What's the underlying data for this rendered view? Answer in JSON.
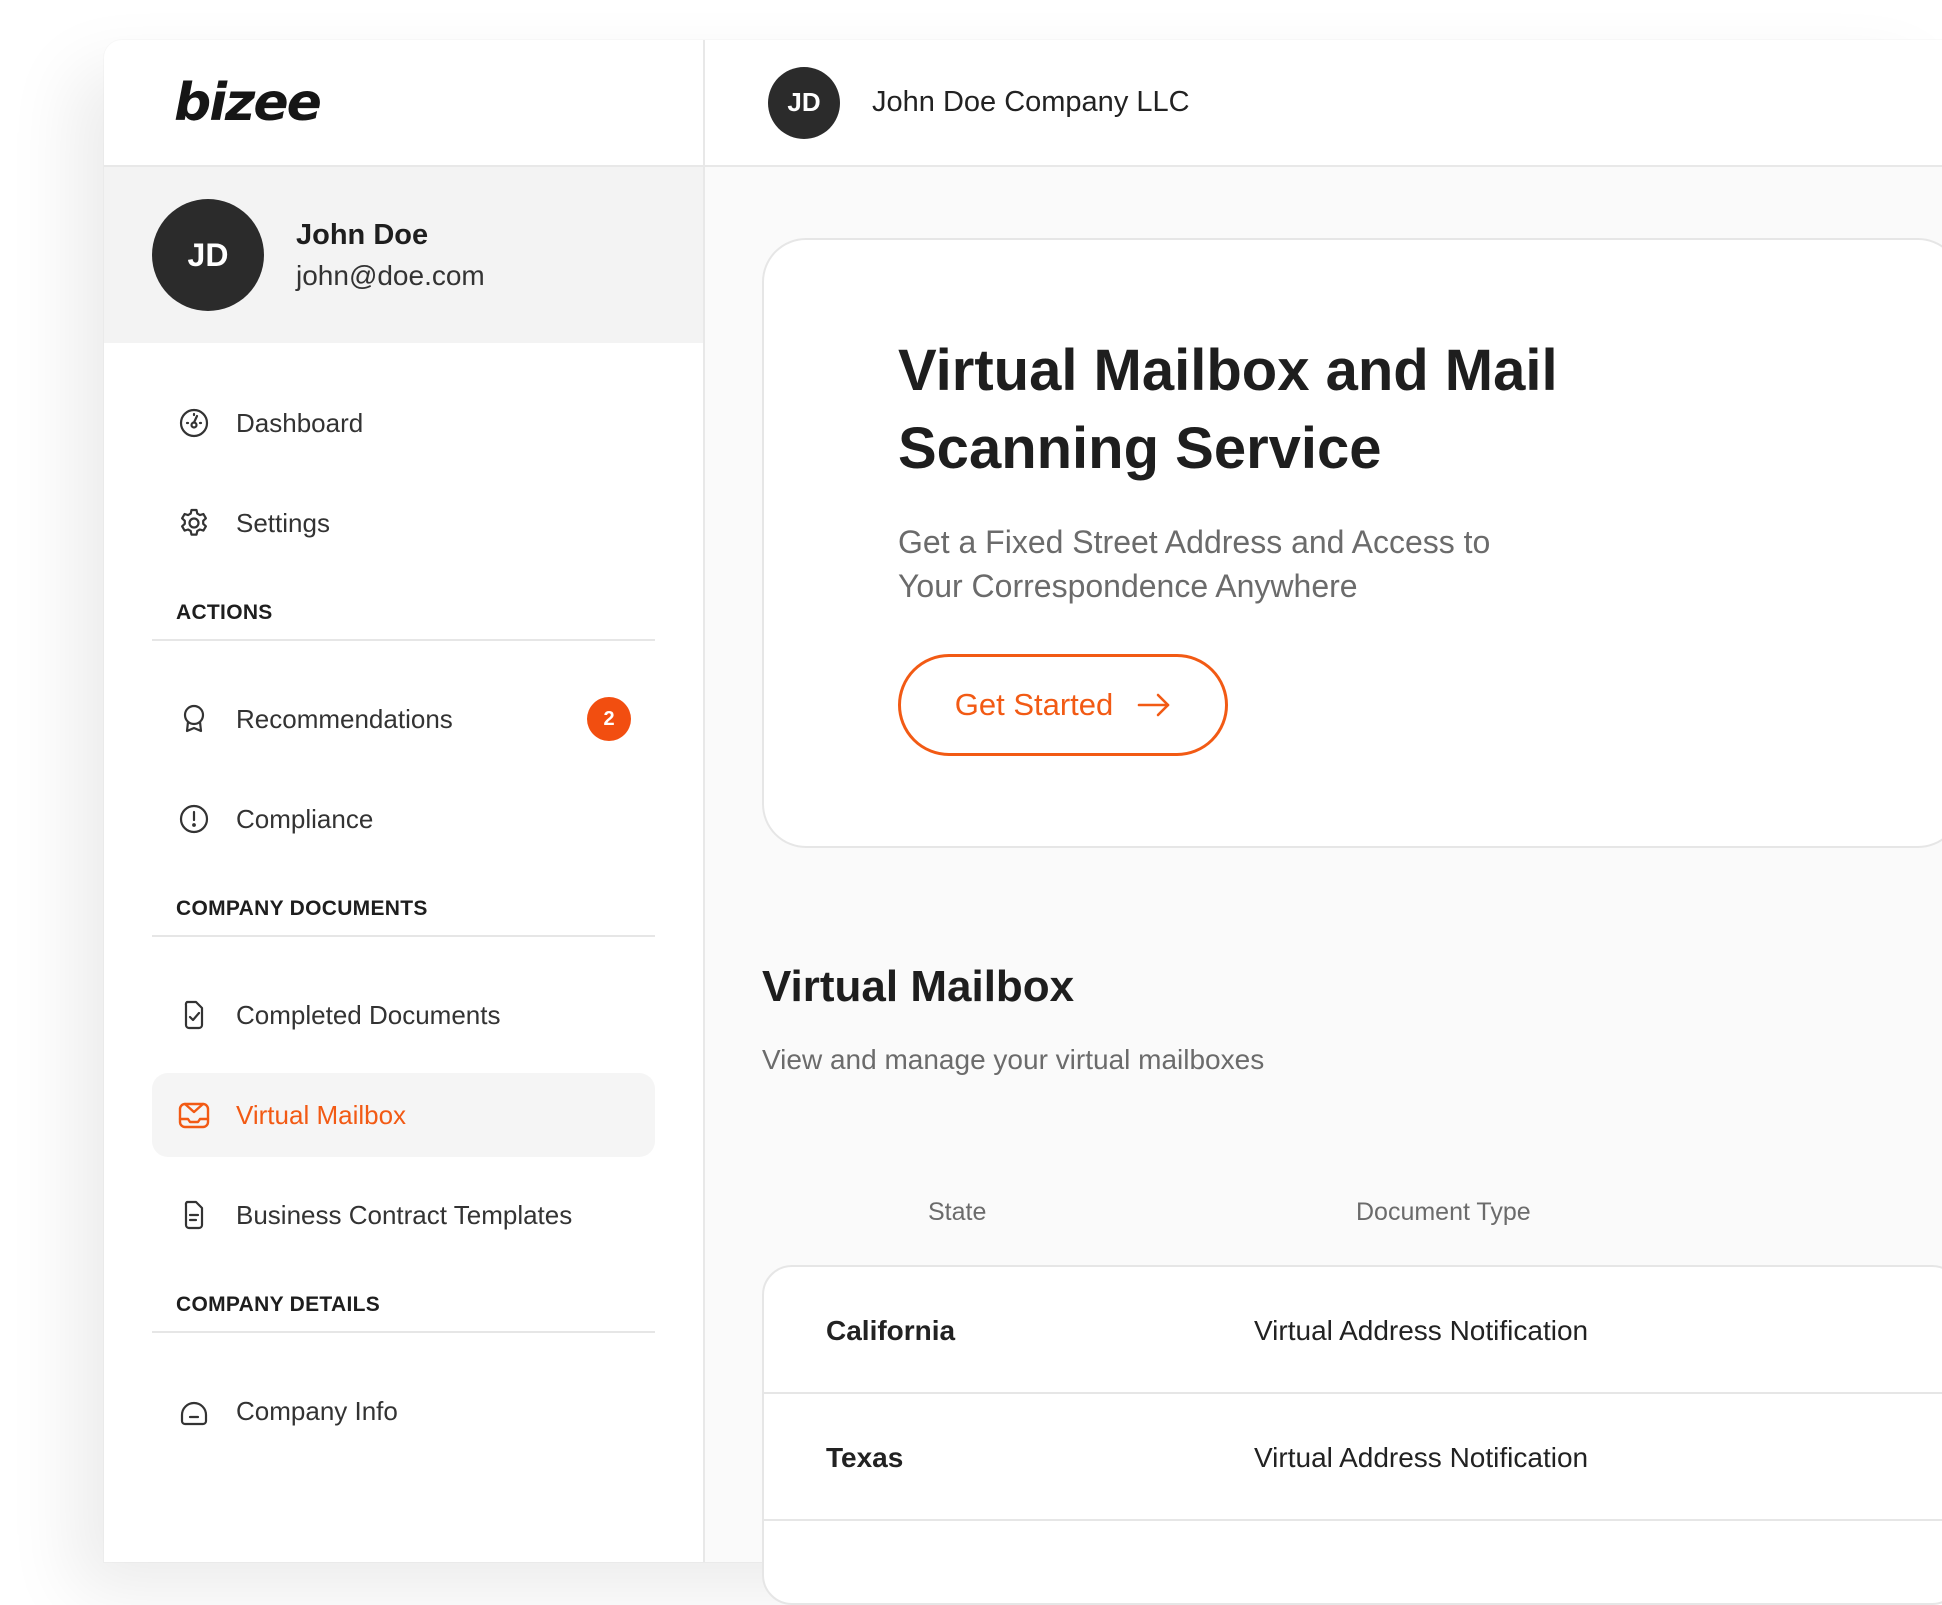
{
  "brand": {
    "logo_text": "bizee",
    "accent": "#f25a14"
  },
  "user": {
    "initials": "JD",
    "name": "John Doe",
    "email": "john@doe.com"
  },
  "topbar": {
    "initials": "JD",
    "company": "John Doe Company LLC"
  },
  "nav": {
    "dashboard": "Dashboard",
    "settings": "Settings",
    "actions_header": "ACTIONS",
    "recommendations": "Recommendations",
    "recommendations_badge": "2",
    "compliance": "Compliance",
    "company_documents_header": "COMPANY DOCUMENTS",
    "completed_documents": "Completed Documents",
    "virtual_mailbox": "Virtual Mailbox",
    "business_contract_templates": "Business Contract Templates",
    "company_details_header": "COMPANY DETAILS",
    "company_info": "Company Info"
  },
  "hero": {
    "title": "Virtual Mailbox and Mail Scanning Service",
    "subtitle": "Get a Fixed Street Address and Access to Your Correspondence Anywhere",
    "cta_label": "Get Started"
  },
  "mailbox": {
    "title": "Virtual Mailbox",
    "subtitle": "View and manage your virtual mailboxes",
    "columns": {
      "state": "State",
      "document_type": "Document Type"
    },
    "rows": [
      {
        "state": "California",
        "document_type": "Virtual Address Notification"
      },
      {
        "state": "Texas",
        "document_type": "Virtual Address Notification"
      }
    ]
  }
}
